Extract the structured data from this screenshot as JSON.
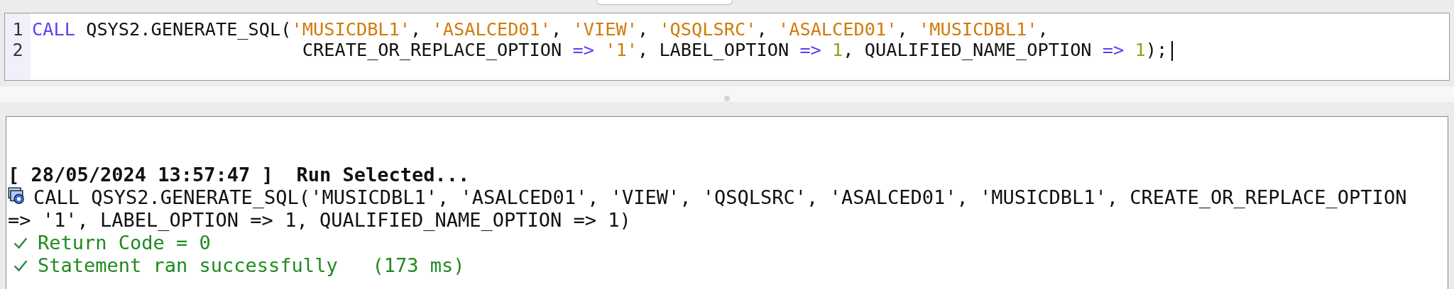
{
  "editor": {
    "lines": [
      {
        "number": "1",
        "tokens": [
          {
            "kind": "keyword",
            "text": "CALL"
          },
          {
            "kind": "plain",
            "text": " QSYS2.GENERATE_SQL("
          },
          {
            "kind": "string",
            "text": "'MUSICDBL1'"
          },
          {
            "kind": "plain",
            "text": ", "
          },
          {
            "kind": "string",
            "text": "'ASALCED01'"
          },
          {
            "kind": "plain",
            "text": ", "
          },
          {
            "kind": "string",
            "text": "'VIEW'"
          },
          {
            "kind": "plain",
            "text": ", "
          },
          {
            "kind": "string",
            "text": "'QSQLSRC'"
          },
          {
            "kind": "plain",
            "text": ", "
          },
          {
            "kind": "string",
            "text": "'ASALCED01'"
          },
          {
            "kind": "plain",
            "text": ", "
          },
          {
            "kind": "string",
            "text": "'MUSICDBL1'"
          },
          {
            "kind": "plain",
            "text": ","
          }
        ]
      },
      {
        "number": "2",
        "tokens": [
          {
            "kind": "plain",
            "text": "                         CREATE_OR_REPLACE_OPTION "
          },
          {
            "kind": "operator",
            "text": "=> "
          },
          {
            "kind": "string",
            "text": "'1'"
          },
          {
            "kind": "plain",
            "text": ", LABEL_OPTION "
          },
          {
            "kind": "operator",
            "text": "=> "
          },
          {
            "kind": "number",
            "text": "1"
          },
          {
            "kind": "plain",
            "text": ", QUALIFIED_NAME_OPTION "
          },
          {
            "kind": "operator",
            "text": "=> "
          },
          {
            "kind": "number",
            "text": "1"
          },
          {
            "kind": "plain",
            "text": ");"
          }
        ]
      }
    ]
  },
  "console": {
    "entries": [
      {
        "kind": "header",
        "lines": [
          "[ 28/05/2024 13:57:47 ]  Run Selected..."
        ]
      },
      {
        "kind": "command",
        "lines": [
          "CALL QSYS2.GENERATE_SQL('MUSICDBL1', 'ASALCED01', 'VIEW', 'QSQLSRC', 'ASALCED01', 'MUSICDBL1', CREATE_OR_REPLACE_OPTION",
          "=> '1', LABEL_OPTION => 1, QUALIFIED_NAME_OPTION => 1)"
        ]
      },
      {
        "kind": "success",
        "lines": [
          "Return Code = 0"
        ]
      },
      {
        "kind": "success",
        "lines": [
          "Statement ran successfully   (173 ms)"
        ]
      }
    ]
  }
}
